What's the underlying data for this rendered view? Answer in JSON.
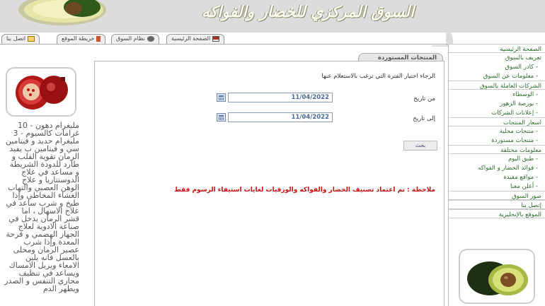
{
  "header": {
    "title": "السوق المركزي للخضار والفواكه"
  },
  "top_links": [
    {
      "label": "الصفحة الرئيسية",
      "icon": "home-icon"
    },
    {
      "label": "نظام السوق",
      "icon": "face-icon"
    },
    {
      "label": "خريطة الموقع",
      "icon": "sitemap-icon"
    },
    {
      "label": "اتصل بنا",
      "icon": "envelope-icon"
    }
  ],
  "sidebar": {
    "items": [
      {
        "label": "الصفحة الرئيسية",
        "type": "heading"
      },
      {
        "label": "تعريف بالسوق",
        "type": "heading"
      },
      {
        "label": "- كادر السوق",
        "type": "sub"
      },
      {
        "label": "- معلومات عن السوق",
        "type": "sub"
      },
      {
        "label": "الشركات العاملة بالسوق",
        "type": "heading"
      },
      {
        "label": "- الوسطاء",
        "type": "sub"
      },
      {
        "label": "- بورصة الزهور",
        "type": "sub"
      },
      {
        "label": "- إعلانات الشركات",
        "type": "sub"
      },
      {
        "label": "اسعار المنتجات",
        "type": "heading"
      },
      {
        "label": "- منتجات محلية",
        "type": "sub"
      },
      {
        "label": "- منتجات مستوردة",
        "type": "sub"
      },
      {
        "label": "معلومات مختلفة",
        "type": "heading"
      },
      {
        "label": "- طبق اليوم",
        "type": "sub"
      },
      {
        "label": "- فوائد الخضار و الفواكه",
        "type": "sub"
      },
      {
        "label": "- مواقع مفيدة",
        "type": "sub"
      },
      {
        "label": "- أعلن معنا",
        "type": "sub"
      },
      {
        "label": "صور السوق",
        "type": "heading"
      },
      {
        "label": "إتصل بنا",
        "type": "heading"
      },
      {
        "label": "الموقع بالإنجليزية",
        "type": "heading"
      }
    ]
  },
  "panel": {
    "tab_label": "المنتجات المستوردة",
    "instruction": "الرجاء اختيار الفترة التي ترغب بالاستعلام عنها",
    "from_label": "من تاريخ",
    "from_value": "11/04/2022",
    "to_label": "إلى تاريخ",
    "to_value": "11/04/2022",
    "search_label": "بحث",
    "note": "ملاحظة : تم اعتماد تصنيف الخضار والفواكه والورقيات لغايات استيفاء الرسوم فقط"
  },
  "left_info": {
    "text": "مليغرام دهون - 10 غرامات كالسيوم - 3 مليغرام حديد و فيتامين سي و فيتامين ب يفيد الرمان تقوية القلب و طارد للدودة الشريطة و مساعد في علاج الدوسنتاريا و علاج الوهن العصبي والتهاب الغشاء المخاطي وإذا طبخ و شرب ساعد في علاج الاسهال ، اما قشر الرمان يدخل في صناعة الادوية لعلاج الجهاز الهضمي و قرحة المعدة وإذا شرب عصير الرمان ومحلى بالعسل فانه يلين الامعاء ويزيل الامساك ويساعد في تنظيف مجاري التنفس و الصدر ويطهر الدم"
  }
}
